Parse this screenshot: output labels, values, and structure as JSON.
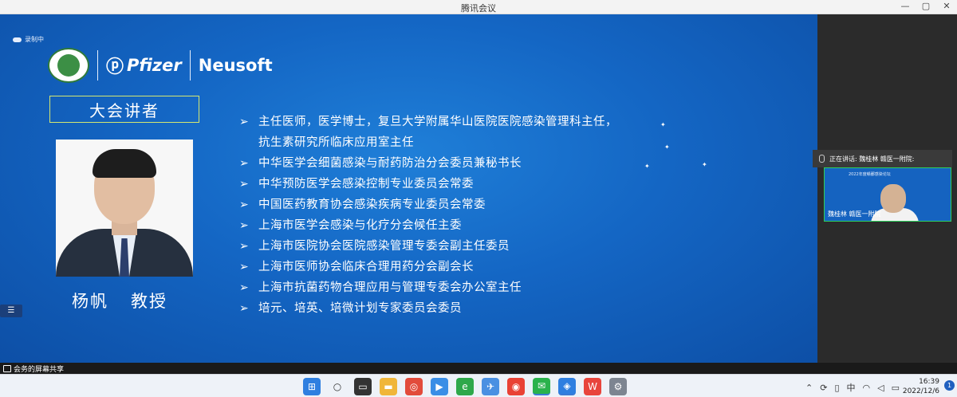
{
  "window": {
    "title": "腾讯会议",
    "controls": [
      "—",
      "▢",
      "✕"
    ]
  },
  "slide": {
    "recording_label": "录制中",
    "logos": {
      "pfizer": "Pfizer",
      "neusoft": "Neusoft"
    },
    "speaker_heading": "大会讲者",
    "speaker_name": "杨帆",
    "speaker_title": "教授",
    "bullets": [
      "主任医师，医学博士，复旦大学附属华山医院医院感染管理科主任，",
      "抗生素研究所临床应用室主任",
      "中华医学会细菌感染与耐药防治分会委员兼秘书长",
      "中华预防医学会感染控制专业委员会常委",
      "中国医药教育协会感染疾病专业委员会常委",
      "上海市医学会感染与化疗分会候任主委",
      "上海市医院协会医院感染管理专委会副主任委员",
      "上海市医师协会临床合理用药分会副会长",
      "上海市抗菌药物合理应用与管理专委会办公室主任",
      "培元、培英、培微计划专家委员会委员"
    ]
  },
  "sidebar": {
    "speaking_label": "正在讲话: 魏桂林 赣医一附院:",
    "video_name": "魏桂林 赣医一附院",
    "video_header": "2022年度赣鄱感染论坛"
  },
  "status": {
    "share_label": "会务的屏幕共享"
  },
  "taskbar": {
    "tray_lang": "中",
    "time": "16:39",
    "date": "2022/12/6",
    "notifications": "1"
  }
}
